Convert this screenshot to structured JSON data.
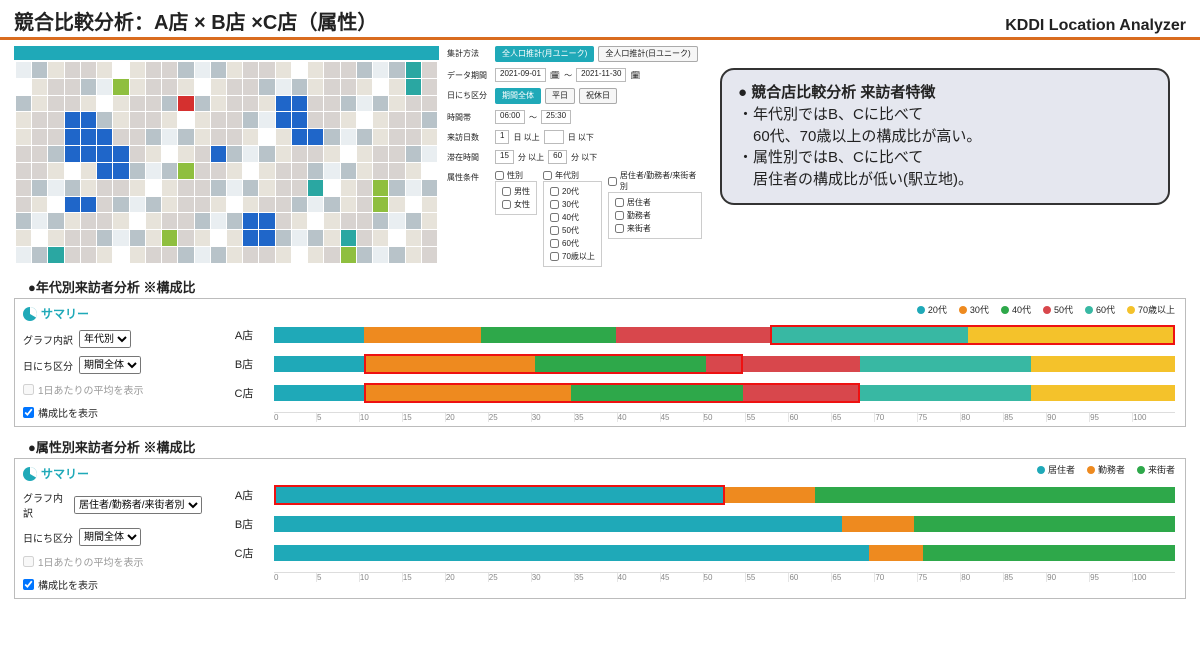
{
  "header": {
    "title": "競合比較分析：A店 × B店 ×C店（属性）",
    "brand": "KDDI Location Analyzer"
  },
  "filters": {
    "agg_label": "集計方法",
    "agg_opt1": "全人口推計(月ユニーク)",
    "agg_opt2": "全人口推計(日ユニーク)",
    "period_label": "データ期間",
    "period_from": "2021-09-01",
    "period_to": "2021-11-30",
    "daytype_label": "日にち区分",
    "daytype_all": "期間全体",
    "daytype_wd": "平日",
    "daytype_hd": "祝休日",
    "timeband_label": "時間帯",
    "time_from": "06:00",
    "time_to": "25:30",
    "visitdays_label": "来訪日数",
    "visitdays_min": "1",
    "visitdays_unit1": "日 以上",
    "visitdays_unit2": "日 以下",
    "stay_label": "滞在時間",
    "stay_min": "15",
    "stay_unit1": "分 以上",
    "stay_max": "60",
    "stay_unit2": "分 以下",
    "attr_label": "属性条件",
    "grp_gender": "性別",
    "grp_age": "年代別",
    "grp_res": "居住者/勤務者/来街者別",
    "male": "男性",
    "female": "女性",
    "a20": "20代",
    "a30": "30代",
    "a40": "40代",
    "a50": "50代",
    "a60": "60代",
    "a70": "70歳以上",
    "resident": "居住者",
    "worker": "勤務者",
    "visitor": "来街者"
  },
  "insight": {
    "title": "● 競合店比較分析 来訪者特徴",
    "line1": "・年代別ではB、Cに比べて",
    "line2": "　60代、70歳以上の構成比が高い。",
    "line3": "・属性別ではB、Cに比べて",
    "line4": "　居住者の構成比が低い(駅立地)。"
  },
  "section1": "●年代別来訪者分析 ※構成比",
  "section2": "●属性別来訪者分析 ※構成比",
  "summary_label": "サマリー",
  "side": {
    "graph_label": "グラフ内訳",
    "opt_age": "年代別",
    "opt_attr": "居住者/勤務者/来街者別",
    "day_label": "日にち区分",
    "day_value": "期間全体",
    "avg_label": "1日あたりの平均を表示",
    "ratio_label": "構成比を表示"
  },
  "legend_age": {
    "a20": "20代",
    "a30": "30代",
    "a40": "40代",
    "a50": "50代",
    "a60": "60代",
    "a70": "70歳以上"
  },
  "legend_attr": {
    "r": "居住者",
    "w": "勤務者",
    "v": "来街者"
  },
  "stores": {
    "a": "A店",
    "b": "B店",
    "c": "C店"
  },
  "axis": [
    "0",
    "5",
    "10",
    "15",
    "20",
    "25",
    "30",
    "35",
    "40",
    "45",
    "50",
    "55",
    "60",
    "65",
    "70",
    "75",
    "80",
    "85",
    "90",
    "95",
    "100"
  ],
  "chart_data": [
    {
      "type": "bar",
      "title": "年代別来訪者分析 ※構成比",
      "orientation": "horizontal-stacked",
      "xlabel": "",
      "ylabel": "",
      "xlim": [
        0,
        100
      ],
      "categories": [
        "A店",
        "B店",
        "C店"
      ],
      "series": [
        {
          "name": "20代",
          "values": [
            10,
            10,
            10
          ]
        },
        {
          "name": "30代",
          "values": [
            13,
            19,
            23
          ]
        },
        {
          "name": "40代",
          "values": [
            15,
            19,
            19
          ]
        },
        {
          "name": "50代",
          "values": [
            17,
            17,
            13
          ]
        },
        {
          "name": "60代",
          "values": [
            22,
            19,
            19
          ]
        },
        {
          "name": "70歳以上",
          "values": [
            23,
            16,
            16
          ]
        }
      ],
      "highlights": [
        {
          "store": "A店",
          "from": 55,
          "to": 100
        },
        {
          "store": "B店",
          "from": 10,
          "to": 52
        },
        {
          "store": "C店",
          "from": 10,
          "to": 65
        }
      ]
    },
    {
      "type": "bar",
      "title": "属性別来訪者分析 ※構成比",
      "orientation": "horizontal-stacked",
      "xlabel": "",
      "ylabel": "",
      "xlim": [
        0,
        100
      ],
      "categories": [
        "A店",
        "B店",
        "C店"
      ],
      "series": [
        {
          "name": "居住者",
          "values": [
            50,
            63,
            66
          ]
        },
        {
          "name": "勤務者",
          "values": [
            10,
            8,
            6
          ]
        },
        {
          "name": "来街者",
          "values": [
            40,
            29,
            28
          ]
        }
      ],
      "highlights": [
        {
          "store": "A店",
          "from": 0,
          "to": 50
        }
      ]
    }
  ]
}
